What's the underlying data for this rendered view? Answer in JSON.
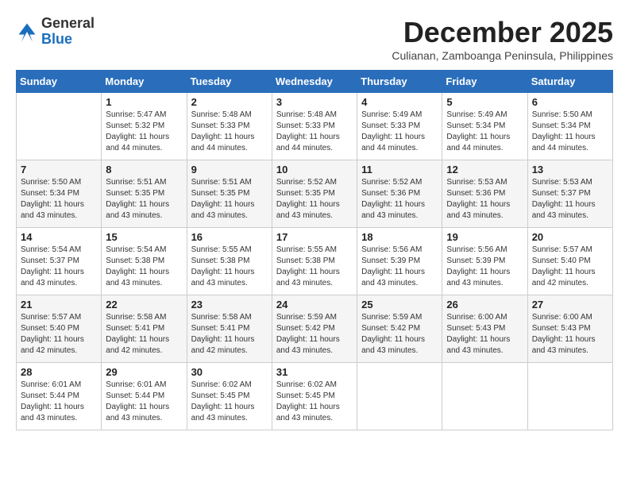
{
  "logo": {
    "general": "General",
    "blue": "Blue"
  },
  "title": {
    "month": "December 2025",
    "location": "Culianan, Zamboanga Peninsula, Philippines"
  },
  "header": {
    "days": [
      "Sunday",
      "Monday",
      "Tuesday",
      "Wednesday",
      "Thursday",
      "Friday",
      "Saturday"
    ]
  },
  "weeks": [
    [
      {
        "day": "",
        "info": ""
      },
      {
        "day": "1",
        "info": "Sunrise: 5:47 AM\nSunset: 5:32 PM\nDaylight: 11 hours\nand 44 minutes."
      },
      {
        "day": "2",
        "info": "Sunrise: 5:48 AM\nSunset: 5:33 PM\nDaylight: 11 hours\nand 44 minutes."
      },
      {
        "day": "3",
        "info": "Sunrise: 5:48 AM\nSunset: 5:33 PM\nDaylight: 11 hours\nand 44 minutes."
      },
      {
        "day": "4",
        "info": "Sunrise: 5:49 AM\nSunset: 5:33 PM\nDaylight: 11 hours\nand 44 minutes."
      },
      {
        "day": "5",
        "info": "Sunrise: 5:49 AM\nSunset: 5:34 PM\nDaylight: 11 hours\nand 44 minutes."
      },
      {
        "day": "6",
        "info": "Sunrise: 5:50 AM\nSunset: 5:34 PM\nDaylight: 11 hours\nand 44 minutes."
      }
    ],
    [
      {
        "day": "7",
        "info": "Sunrise: 5:50 AM\nSunset: 5:34 PM\nDaylight: 11 hours\nand 43 minutes."
      },
      {
        "day": "8",
        "info": "Sunrise: 5:51 AM\nSunset: 5:35 PM\nDaylight: 11 hours\nand 43 minutes."
      },
      {
        "day": "9",
        "info": "Sunrise: 5:51 AM\nSunset: 5:35 PM\nDaylight: 11 hours\nand 43 minutes."
      },
      {
        "day": "10",
        "info": "Sunrise: 5:52 AM\nSunset: 5:35 PM\nDaylight: 11 hours\nand 43 minutes."
      },
      {
        "day": "11",
        "info": "Sunrise: 5:52 AM\nSunset: 5:36 PM\nDaylight: 11 hours\nand 43 minutes."
      },
      {
        "day": "12",
        "info": "Sunrise: 5:53 AM\nSunset: 5:36 PM\nDaylight: 11 hours\nand 43 minutes."
      },
      {
        "day": "13",
        "info": "Sunrise: 5:53 AM\nSunset: 5:37 PM\nDaylight: 11 hours\nand 43 minutes."
      }
    ],
    [
      {
        "day": "14",
        "info": "Sunrise: 5:54 AM\nSunset: 5:37 PM\nDaylight: 11 hours\nand 43 minutes."
      },
      {
        "day": "15",
        "info": "Sunrise: 5:54 AM\nSunset: 5:38 PM\nDaylight: 11 hours\nand 43 minutes."
      },
      {
        "day": "16",
        "info": "Sunrise: 5:55 AM\nSunset: 5:38 PM\nDaylight: 11 hours\nand 43 minutes."
      },
      {
        "day": "17",
        "info": "Sunrise: 5:55 AM\nSunset: 5:38 PM\nDaylight: 11 hours\nand 43 minutes."
      },
      {
        "day": "18",
        "info": "Sunrise: 5:56 AM\nSunset: 5:39 PM\nDaylight: 11 hours\nand 43 minutes."
      },
      {
        "day": "19",
        "info": "Sunrise: 5:56 AM\nSunset: 5:39 PM\nDaylight: 11 hours\nand 43 minutes."
      },
      {
        "day": "20",
        "info": "Sunrise: 5:57 AM\nSunset: 5:40 PM\nDaylight: 11 hours\nand 42 minutes."
      }
    ],
    [
      {
        "day": "21",
        "info": "Sunrise: 5:57 AM\nSunset: 5:40 PM\nDaylight: 11 hours\nand 42 minutes."
      },
      {
        "day": "22",
        "info": "Sunrise: 5:58 AM\nSunset: 5:41 PM\nDaylight: 11 hours\nand 42 minutes."
      },
      {
        "day": "23",
        "info": "Sunrise: 5:58 AM\nSunset: 5:41 PM\nDaylight: 11 hours\nand 42 minutes."
      },
      {
        "day": "24",
        "info": "Sunrise: 5:59 AM\nSunset: 5:42 PM\nDaylight: 11 hours\nand 43 minutes."
      },
      {
        "day": "25",
        "info": "Sunrise: 5:59 AM\nSunset: 5:42 PM\nDaylight: 11 hours\nand 43 minutes."
      },
      {
        "day": "26",
        "info": "Sunrise: 6:00 AM\nSunset: 5:43 PM\nDaylight: 11 hours\nand 43 minutes."
      },
      {
        "day": "27",
        "info": "Sunrise: 6:00 AM\nSunset: 5:43 PM\nDaylight: 11 hours\nand 43 minutes."
      }
    ],
    [
      {
        "day": "28",
        "info": "Sunrise: 6:01 AM\nSunset: 5:44 PM\nDaylight: 11 hours\nand 43 minutes."
      },
      {
        "day": "29",
        "info": "Sunrise: 6:01 AM\nSunset: 5:44 PM\nDaylight: 11 hours\nand 43 minutes."
      },
      {
        "day": "30",
        "info": "Sunrise: 6:02 AM\nSunset: 5:45 PM\nDaylight: 11 hours\nand 43 minutes."
      },
      {
        "day": "31",
        "info": "Sunrise: 6:02 AM\nSunset: 5:45 PM\nDaylight: 11 hours\nand 43 minutes."
      },
      {
        "day": "",
        "info": ""
      },
      {
        "day": "",
        "info": ""
      },
      {
        "day": "",
        "info": ""
      }
    ]
  ]
}
